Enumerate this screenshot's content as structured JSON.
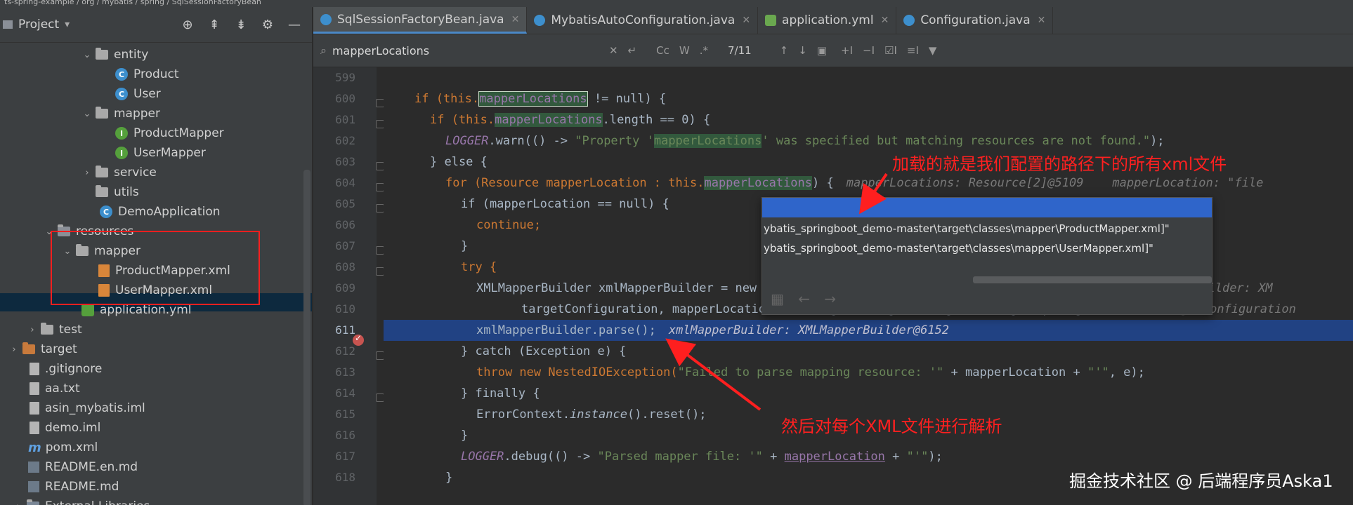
{
  "window_title": "ts-spring-example / org / mybatis / spring / SqlSessionFactoryBean",
  "project_panel": {
    "label": "Project",
    "dropdown": "▾",
    "tree": [
      {
        "label": "entity",
        "kind": "folder",
        "open": true
      },
      {
        "label": "Product",
        "kind": "class"
      },
      {
        "label": "User",
        "kind": "class"
      },
      {
        "label": "mapper",
        "kind": "folder",
        "open": true
      },
      {
        "label": "ProductMapper",
        "kind": "interface"
      },
      {
        "label": "UserMapper",
        "kind": "interface"
      },
      {
        "label": "service",
        "kind": "folder",
        "open": false
      },
      {
        "label": "utils",
        "kind": "folder"
      },
      {
        "label": "DemoApplication",
        "kind": "class"
      },
      {
        "label": "resources",
        "kind": "folder",
        "open": true
      },
      {
        "label": "mapper",
        "kind": "folder",
        "open": true
      },
      {
        "label": "ProductMapper.xml",
        "kind": "xml"
      },
      {
        "label": "UserMapper.xml",
        "kind": "xml"
      },
      {
        "label": "application.yml",
        "kind": "yml"
      },
      {
        "label": "test",
        "kind": "folder",
        "open": false
      },
      {
        "label": "target",
        "kind": "folder-orange",
        "open": false
      },
      {
        "label": ".gitignore",
        "kind": "file"
      },
      {
        "label": "aa.txt",
        "kind": "file"
      },
      {
        "label": "asin_mybatis.iml",
        "kind": "file"
      },
      {
        "label": "demo.iml",
        "kind": "file"
      },
      {
        "label": "pom.xml",
        "kind": "maven"
      },
      {
        "label": "README.en.md",
        "kind": "md"
      },
      {
        "label": "README.md",
        "kind": "md"
      },
      {
        "label": "External Libraries",
        "kind": "lib"
      }
    ]
  },
  "tabs": [
    {
      "label": "SqlSessionFactoryBean.java",
      "active": true
    },
    {
      "label": "MybatisAutoConfiguration.java",
      "active": false
    },
    {
      "label": "application.yml",
      "active": false
    },
    {
      "label": "Configuration.java",
      "active": false
    }
  ],
  "find_bar": {
    "query": "mapperLocations",
    "match_count": "7/11",
    "option_cc": "Cc",
    "option_w": "W",
    "option_regex": ".*"
  },
  "line_numbers": [
    "599",
    "600",
    "601",
    "602",
    "603",
    "604",
    "605",
    "606",
    "607",
    "608",
    "609",
    "610",
    "611",
    "612",
    "613",
    "614",
    "615",
    "616",
    "617",
    "618"
  ],
  "code": {
    "l600_pre": "if (this.",
    "l600_match": "mapperLocations",
    "l600_post": " != null) {",
    "l601_pre": "if (this.",
    "l601_match": "mapperLocations",
    "l601_post": ".length == 0) {",
    "l602_log": "LOGGER",
    "l602_a": ".warn(() -> ",
    "l602_s1": "\"Property '",
    "l602_match": "mapperLocations",
    "l602_s2": "' was specified but matching resources are not found.\"",
    "l602_end": ");",
    "l603": "} else {",
    "l604_a": "for (Resource mapperLocation : this.",
    "l604_match": "mapperLocations",
    "l604_b": ") {",
    "l604_hint": "mapperLocations: Resource[2]@5109    mapperLocation: \"file",
    "l605": "if (mapperLocation == null) {",
    "l606": "continue;",
    "l607": "}",
    "l608": "try {",
    "l609": "XMLMapperBuilder xmlMapperBuilder = new XMLMapperBuilder(mapperLocation.getInputStream(),",
    "l609_hint": "xmlMapperBuilder: XM",
    "l610": "targetConfiguration, mapperLocation.toString(), targetConfiguration.getSqlFragments());",
    "l610_hint": "targetConfiguration",
    "l611": "xmlMapperBuilder.parse();",
    "l611_hint": "xmlMapperBuilder: XMLMapperBuilder@6152",
    "l612": "} catch (Exception e) {",
    "l613_a": "throw new NestedIOException(",
    "l613_s": "\"Failed to parse mapping resource: '\"",
    "l613_b": " + mapperLocation + ",
    "l613_s2": "\"'\"",
    "l613_c": ", e);",
    "l614": "} finally {",
    "l615_a": "ErrorContext.",
    "l615_i": "instance",
    "l615_b": "().reset();",
    "l616": "}",
    "l617_log": "LOGGER",
    "l617_a": ".debug(() -> ",
    "l617_s": "\"Parsed mapper file: '\"",
    "l617_b": " + ",
    "l617_u": "mapperLocation",
    "l617_c": " + ",
    "l617_s2": "\"'\"",
    "l617_d": ");",
    "l618": "}"
  },
  "popup": {
    "items": [
      "ybatis_springboot_demo-master\\target\\classes\\mapper\\ProductMapper.xml]\"",
      "ybatis_springboot_demo-master\\target\\classes\\mapper\\UserMapper.xml]\""
    ]
  },
  "annotations": {
    "top": "加载的就是我们配置的路径下的所有xml文件",
    "bottom": "然后对每个XML文件进行解析"
  },
  "watermark": "掘金技术社区 @ 后端程序员Aska1",
  "colors": {
    "accent": "#4a88c7",
    "annotation": "#ff2020",
    "highlight_line": "#214283"
  }
}
